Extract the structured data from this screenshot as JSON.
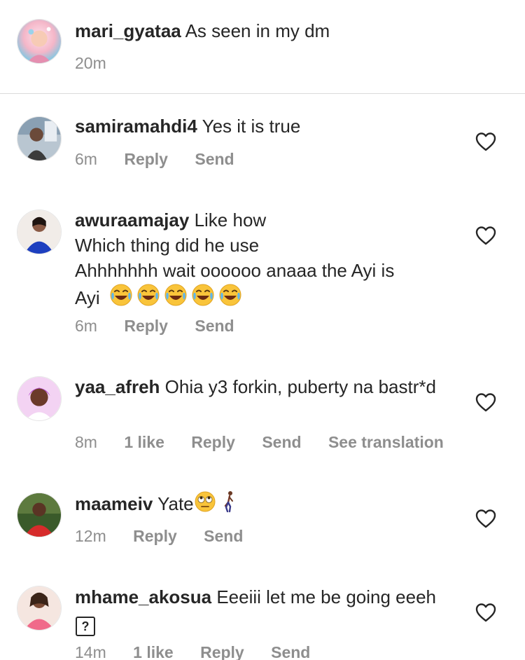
{
  "comments": [
    {
      "username": "mari_gyataa",
      "text": "As seen in my dm",
      "time": "20m",
      "avatar_colors": [
        "#f4b6c8",
        "#7ec8e3"
      ]
    },
    {
      "username": "samiramahdi4",
      "text": "Yes it is true",
      "time": "6m",
      "reply_label": "Reply",
      "send_label": "Send",
      "avatar_colors": [
        "#8aa0b3",
        "#3b3b3b"
      ]
    },
    {
      "username": "awuraamajay",
      "text_lines": [
        "Like how",
        "Which thing did he use",
        "Ahhhhhhh wait oooooo anaaa the Ayi is",
        "Ayi"
      ],
      "emoji_count": 5,
      "time": "6m",
      "reply_label": "Reply",
      "send_label": "Send",
      "avatar_colors": [
        "#1d3fbf",
        "#c98a6c"
      ]
    },
    {
      "username": "yaa_afreh",
      "text": "Ohia y3 forkin, puberty na bastr*d",
      "time": "8m",
      "likes_label": "1 like",
      "reply_label": "Reply",
      "send_label": "Send",
      "translation_label": "See translation",
      "avatar_colors": [
        "#b044c9",
        "#f3d3f3"
      ]
    },
    {
      "username": "maameiv",
      "text": "Yate",
      "time": "12m",
      "reply_label": "Reply",
      "send_label": "Send",
      "avatar_colors": [
        "#d62b2b",
        "#3a5a2a"
      ]
    },
    {
      "username": "mhame_akosua",
      "text": "Eeeiii let me be going eeeh",
      "unknown_glyph": "?",
      "time": "14m",
      "likes_label": "1 like",
      "reply_label": "Reply",
      "send_label": "Send",
      "avatar_colors": [
        "#f06a8a",
        "#5b3b2b"
      ]
    }
  ],
  "icons": {
    "heart": "heart-outline-icon",
    "laugh": "face-with-tears-of-joy-emoji",
    "eyeroll": "face-with-rolling-eyes-emoji",
    "walk": "person-walking-emoji"
  },
  "colors": {
    "text_primary": "#262626",
    "text_secondary": "#8e8e8e",
    "divider": "#dbdbdb"
  }
}
